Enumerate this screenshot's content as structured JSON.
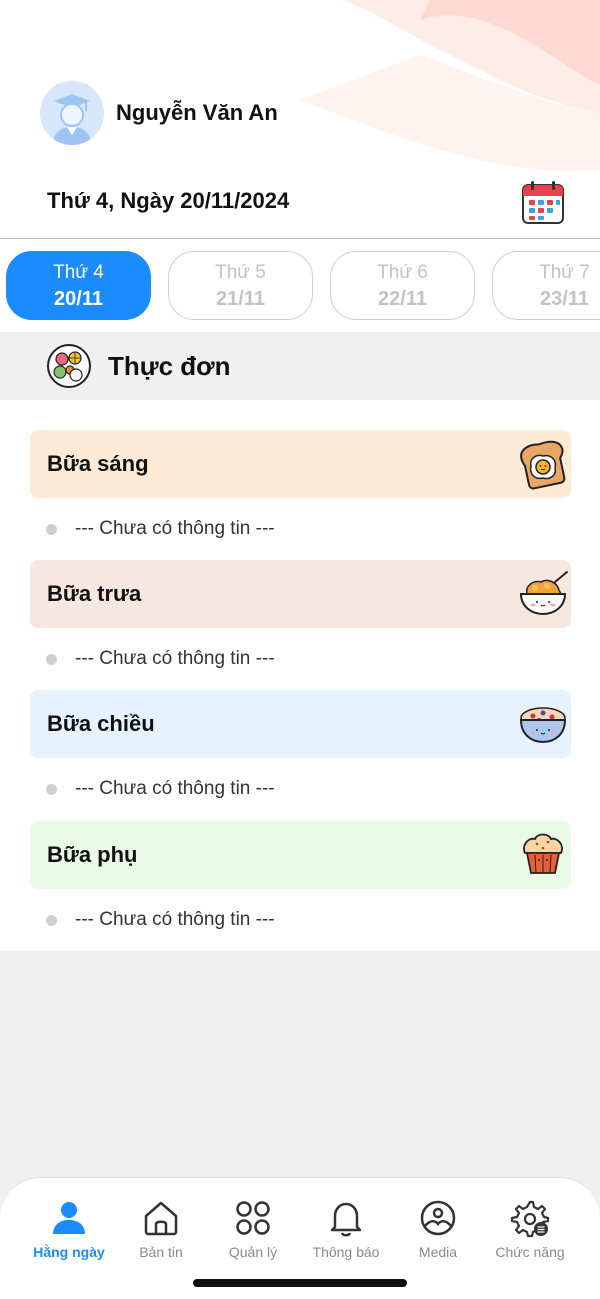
{
  "profile": {
    "name": "Nguyễn Văn An"
  },
  "date_line": "Thứ 4, Ngày 20/11/2024",
  "days": [
    {
      "weekday": "Thứ 4",
      "date": "20/11",
      "active": true
    },
    {
      "weekday": "Thứ 5",
      "date": "21/11",
      "active": false
    },
    {
      "weekday": "Thứ 6",
      "date": "22/11",
      "active": false
    },
    {
      "weekday": "Thứ 7",
      "date": "23/11",
      "active": false
    }
  ],
  "menu": {
    "title": "Thực đơn",
    "meals": [
      {
        "name": "Bữa sáng",
        "note": "--- Chưa có thông tin ---",
        "color": "#fdebd6",
        "icon": "toast-egg-icon"
      },
      {
        "name": "Bữa trưa",
        "note": "--- Chưa có thông tin ---",
        "color": "#f7e7e1",
        "icon": "rice-bowl-icon"
      },
      {
        "name": "Bữa chiều",
        "note": "--- Chưa có thông tin ---",
        "color": "#e6f2fe",
        "icon": "berry-bowl-icon"
      },
      {
        "name": "Bữa phụ",
        "note": "--- Chưa có thông tin ---",
        "color": "#e9fbe6",
        "icon": "muffin-icon"
      }
    ]
  },
  "tabs": [
    {
      "label": "Hằng ngày",
      "icon": "person-icon",
      "active": true
    },
    {
      "label": "Bản tin",
      "icon": "home-icon",
      "active": false
    },
    {
      "label": "Quản lý",
      "icon": "grid-icon",
      "active": false
    },
    {
      "label": "Thông báo",
      "icon": "bell-icon",
      "active": false
    },
    {
      "label": "Media",
      "icon": "image-icon",
      "active": false
    },
    {
      "label": "Chức năng",
      "icon": "gear-icon",
      "active": false
    }
  ],
  "colors": {
    "accent": "#1a8cff",
    "tab_inactive": "#8a8a8a"
  }
}
